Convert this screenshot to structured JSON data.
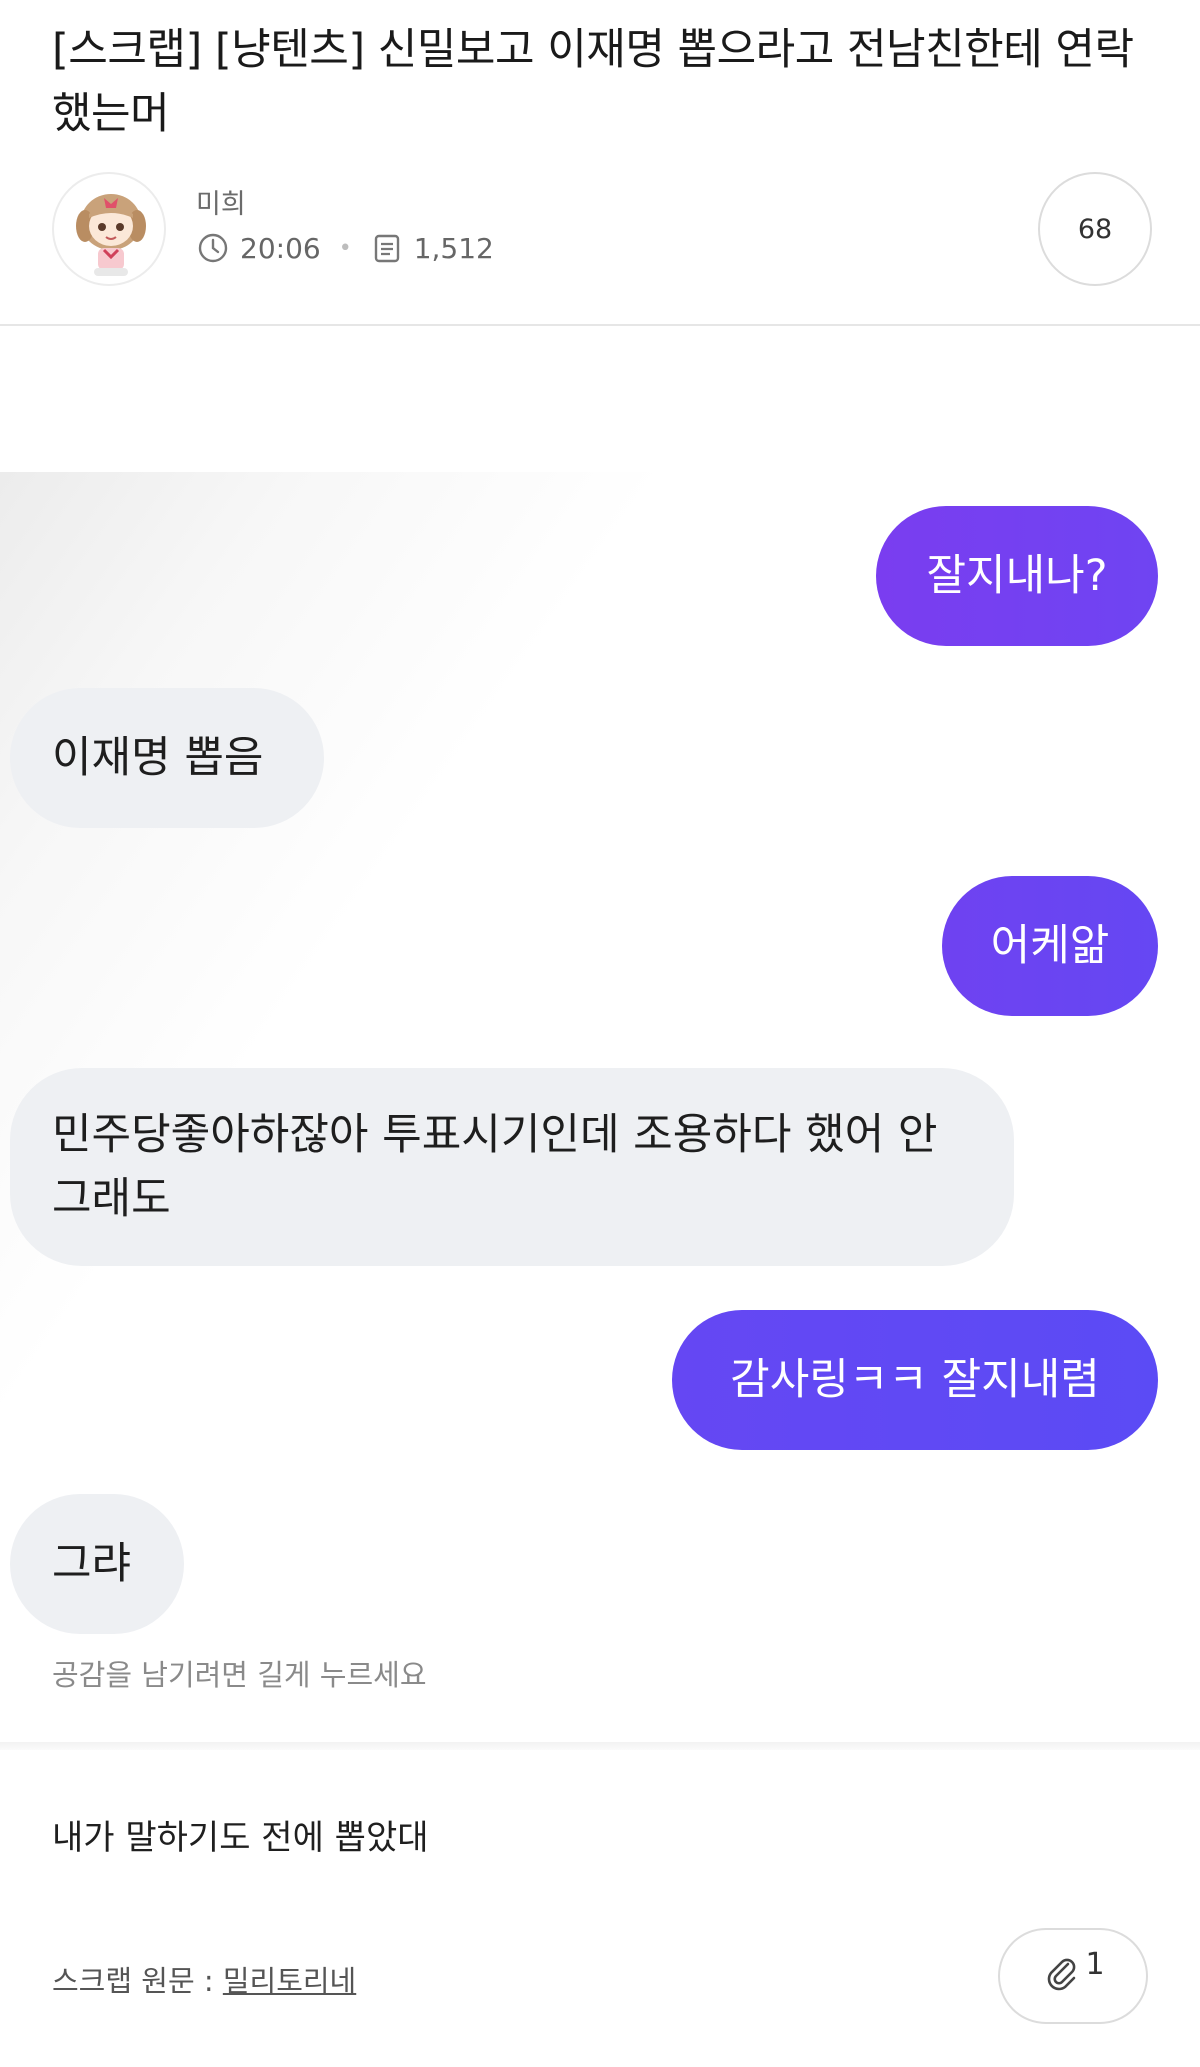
{
  "post": {
    "title": "[스크랩] [냥텐츠] 신밀보고 이재명 뽑으라고 전남친한테 연락했는머",
    "author": "미희",
    "time": "20:06",
    "views": "1,512",
    "comment_count": "68"
  },
  "chat": {
    "messages": [
      {
        "side": "out",
        "text": "잘지내나?"
      },
      {
        "side": "in",
        "text": "이재명 뽑음"
      },
      {
        "side": "out",
        "text": "어케앎"
      },
      {
        "side": "in",
        "text": "민주당좋아하잖아 투표시기인데 조용하다 했어 안그래도"
      },
      {
        "side": "out",
        "text": "감사링ㅋㅋ 잘지내렴"
      },
      {
        "side": "in",
        "text": "그랴"
      }
    ],
    "hint": "공감을 남기려면 길게 누르세요",
    "colors": {
      "out_start": "#7a3df0",
      "out_end": "#5b4bf5",
      "in_bg": "#eef0f3"
    }
  },
  "body": {
    "text": "내가 말하기도 전에 뽑았대"
  },
  "footer": {
    "source_label": "스크랩 원문 : ",
    "source_link": "밀리토리네",
    "attachment_count": "1"
  },
  "icons": {
    "clock": "clock-icon",
    "views": "document-icon",
    "attachment": "paperclip-icon"
  }
}
